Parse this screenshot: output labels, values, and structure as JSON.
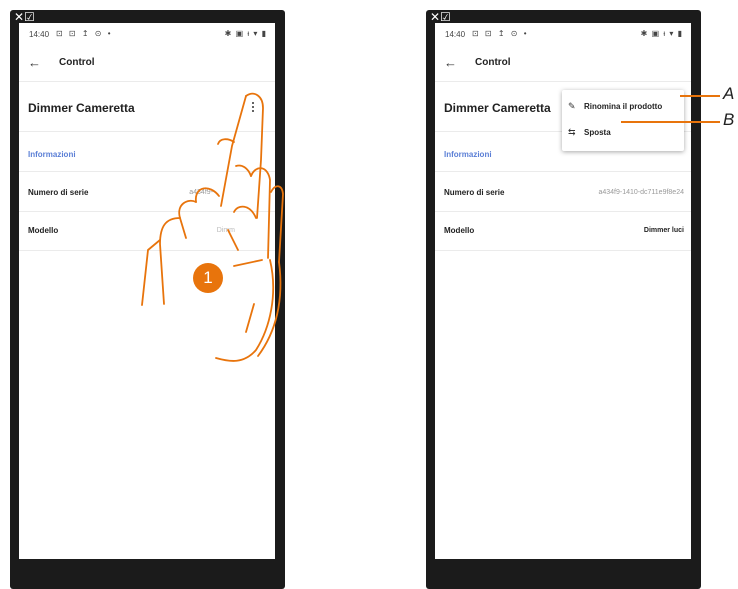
{
  "topglyph": "✕☑",
  "accent": "#e8740c",
  "status_bar": {
    "time": "14:40",
    "icons": "⊡ ⊡ ↥ ⊙ •",
    "right": "✱ ▣ ᵻ ▾ ▮"
  },
  "app_bar": {
    "title": "Control"
  },
  "product": {
    "name": "Dimmer Cameretta"
  },
  "section": {
    "label": "Informazioni"
  },
  "rows": [
    {
      "label": "Numero di serie",
      "value": "a434f9-1410-dc711e9f8e24"
    },
    {
      "label": "Modello",
      "value": "Dimmer luci"
    }
  ],
  "left_partial_values": [
    "a434f9-",
    "Dimm"
  ],
  "step_badge": "1",
  "menu": {
    "items": [
      {
        "label": "Rinomina il prodotto",
        "icon": "pencil-icon",
        "callout": "A"
      },
      {
        "label": "Sposta",
        "icon": "move-arrows-icon",
        "callout": "B"
      }
    ]
  }
}
